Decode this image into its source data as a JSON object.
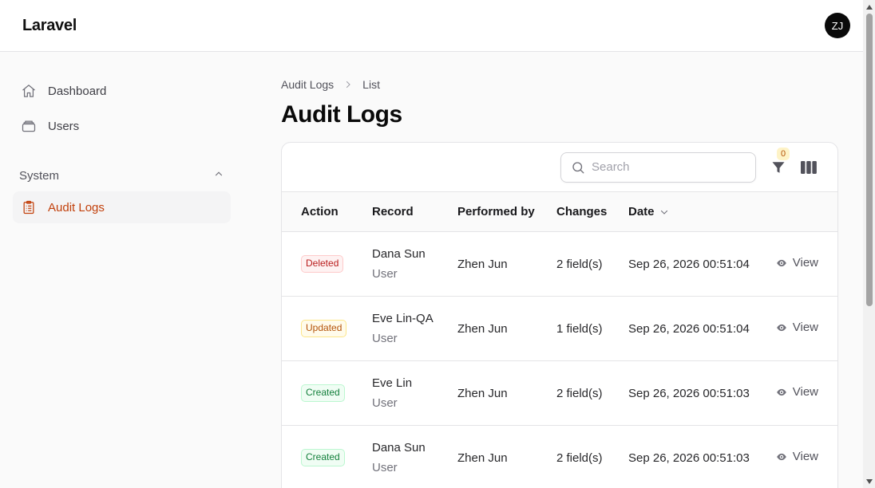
{
  "app": {
    "brand": "Laravel",
    "user_initials": "ZJ"
  },
  "sidebar": {
    "items": [
      {
        "label": "Dashboard",
        "icon": "home-icon"
      },
      {
        "label": "Users",
        "icon": "stack-icon"
      }
    ],
    "group": {
      "label": "System",
      "items": [
        {
          "label": "Audit Logs",
          "icon": "clipboard-icon",
          "active": true
        }
      ]
    }
  },
  "breadcrumbs": [
    "Audit Logs",
    "List"
  ],
  "page": {
    "title": "Audit Logs"
  },
  "table": {
    "search_placeholder": "Search",
    "filter_count": "0",
    "columns": [
      "Action",
      "Record",
      "Performed by",
      "Changes",
      "Date"
    ],
    "view_label": "View",
    "rows": [
      {
        "action": "Deleted",
        "record": "Dana Sun",
        "record_type": "User",
        "performed_by": "Zhen Jun",
        "changes": "2 field(s)",
        "date": "Sep 26, 2026 00:51:04"
      },
      {
        "action": "Updated",
        "record": "Eve Lin-QA",
        "record_type": "User",
        "performed_by": "Zhen Jun",
        "changes": "1 field(s)",
        "date": "Sep 26, 2026 00:51:04"
      },
      {
        "action": "Created",
        "record": "Eve Lin",
        "record_type": "User",
        "performed_by": "Zhen Jun",
        "changes": "2 field(s)",
        "date": "Sep 26, 2026 00:51:03"
      },
      {
        "action": "Created",
        "record": "Dana Sun",
        "record_type": "User",
        "performed_by": "Zhen Jun",
        "changes": "2 field(s)",
        "date": "Sep 26, 2026 00:51:03"
      }
    ]
  },
  "colors": {
    "accent": "#c2410c",
    "deleted": "#b91c1c",
    "updated": "#b45309",
    "created": "#15803d"
  }
}
